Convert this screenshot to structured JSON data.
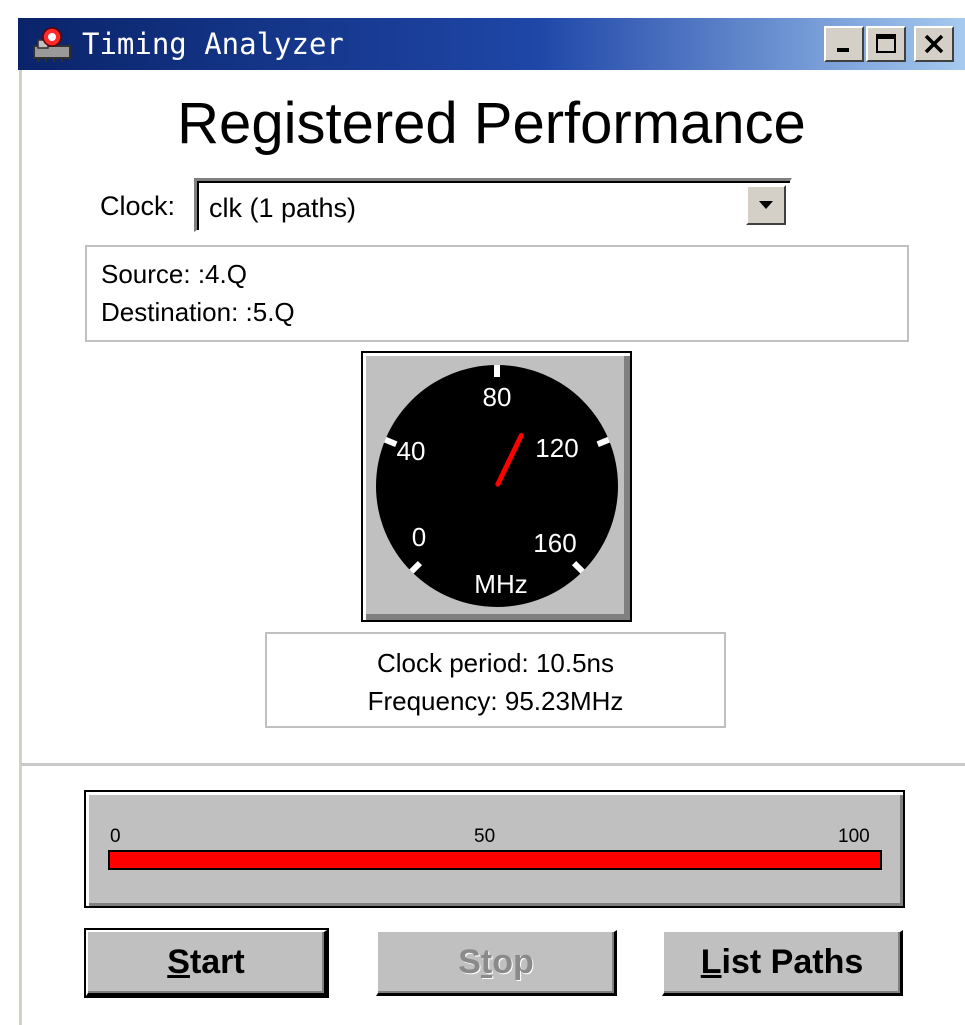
{
  "window": {
    "title": "Timing Analyzer",
    "icons": {
      "app": "timing-analyzer-app-icon",
      "minimize": "minimize-icon",
      "maximize": "maximize-icon",
      "close": "close-icon"
    }
  },
  "heading": "Registered Performance",
  "clock": {
    "label": "Clock:",
    "selected": "clk (1 paths)",
    "dropdown_icon": "chevron-down-icon"
  },
  "path_info": {
    "source": "Source: :4.Q",
    "destination": "Destination: :5.Q"
  },
  "gauge": {
    "ticks": [
      "0",
      "40",
      "80",
      "120",
      "160"
    ],
    "unit": "MHz",
    "min": 0,
    "max": 160,
    "value_mhz": 95.23,
    "face_color": "#000000",
    "needle_color": "#ff0000",
    "tick_color": "#ffffff"
  },
  "timing": {
    "period": "Clock period: 10.5ns",
    "frequency": "Frequency: 95.23MHz"
  },
  "progress": {
    "ticks": [
      "0",
      "50",
      "100"
    ],
    "value_percent": 100,
    "fill_color": "#ff0000"
  },
  "buttons": {
    "start": {
      "mnemonic": "S",
      "rest": "tart"
    },
    "stop": {
      "pre": "S",
      "mnemonic": "t",
      "rest": "op"
    },
    "list_paths": {
      "mnemonic": "L",
      "rest": "ist Paths"
    }
  }
}
